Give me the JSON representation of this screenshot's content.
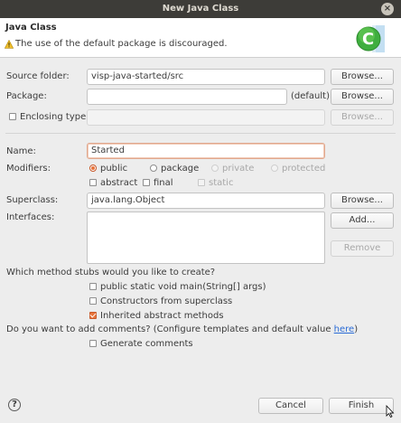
{
  "window": {
    "title": "New Java Class",
    "close_glyph": "×"
  },
  "banner": {
    "title": "Java Class",
    "message": "The use of the default package is discouraged.",
    "warning_icon": "warning-icon",
    "logo_icon": "java-class-wizard-icon",
    "logo_letter": "C"
  },
  "form": {
    "source_folder": {
      "label": "Source folder:",
      "value": "visp-java-started/src",
      "button": "Browse..."
    },
    "package": {
      "label": "Package:",
      "value": "",
      "suffix": "(default)",
      "button": "Browse..."
    },
    "enclosing_type": {
      "label": "Enclosing type:",
      "value": "",
      "button": "Browse...",
      "checked": false
    },
    "name": {
      "label": "Name:",
      "value": "Started"
    },
    "modifiers": {
      "label": "Modifiers:",
      "access": [
        "public",
        "package",
        "private",
        "protected"
      ],
      "selected": "public",
      "flags": [
        "abstract",
        "final",
        "static"
      ]
    },
    "superclass": {
      "label": "Superclass:",
      "value": "java.lang.Object",
      "button": "Browse..."
    },
    "interfaces": {
      "label": "Interfaces:",
      "add_button": "Add...",
      "remove_button": "Remove"
    }
  },
  "stubs": {
    "question": "Which method stubs would you like to create?",
    "options": [
      {
        "label": "public static void main(String[] args)",
        "checked": false
      },
      {
        "label": "Constructors from superclass",
        "checked": false
      },
      {
        "label": "Inherited abstract methods",
        "checked": true
      }
    ]
  },
  "comments": {
    "question_prefix": "Do you want to add comments? (Configure templates and default value ",
    "link": "here",
    "question_suffix": ")",
    "option": {
      "label": "Generate comments",
      "checked": false
    }
  },
  "footer": {
    "help_glyph": "?",
    "cancel": "Cancel",
    "finish": "Finish"
  },
  "colors": {
    "accent": "#e8743b",
    "titlebar": "#3d3c38",
    "logo": "#3fae3f"
  }
}
